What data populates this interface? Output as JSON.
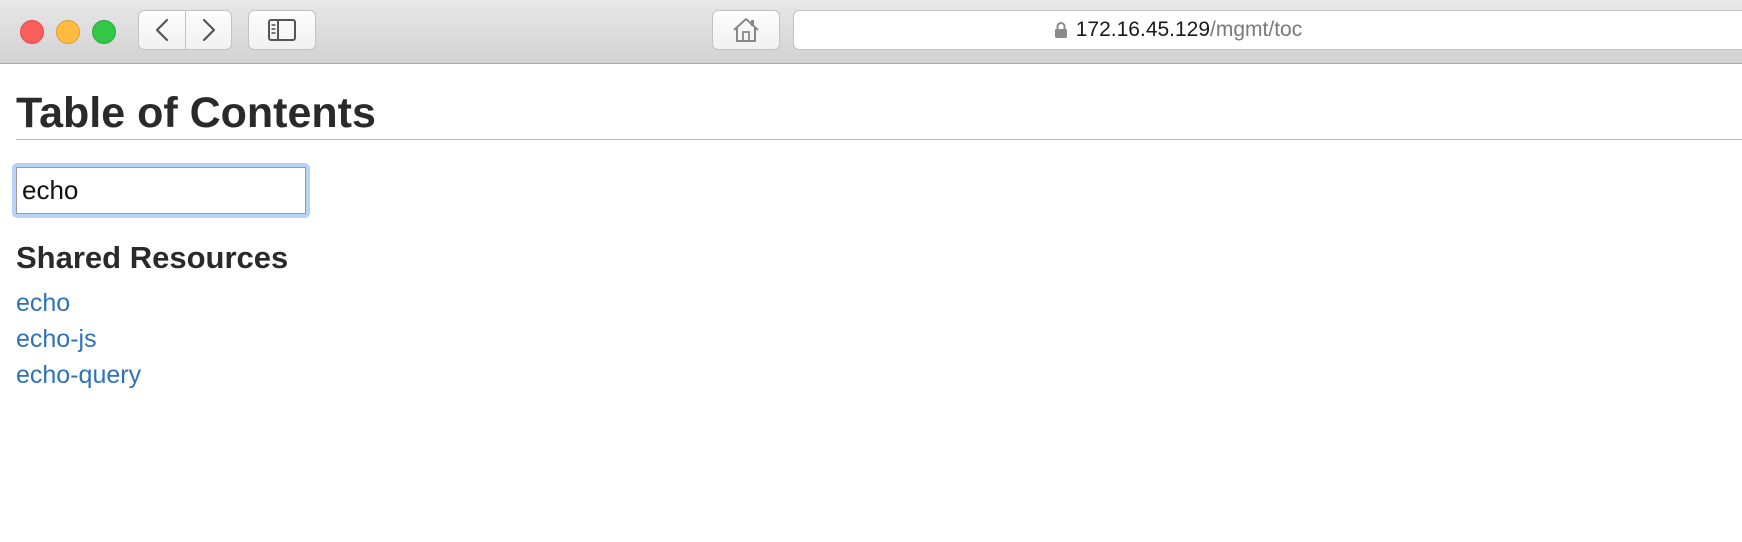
{
  "browser": {
    "url_host": "172.16.45.129",
    "url_path": "/mgmt/toc"
  },
  "page": {
    "title": "Table of Contents",
    "search": {
      "value": "echo",
      "placeholder": ""
    },
    "section_title": "Shared Resources",
    "links": [
      "echo",
      "echo-js",
      "echo-query"
    ]
  },
  "colors": {
    "link": "#2f72b8",
    "focus_ring": "#b5d5f8"
  },
  "icons": {
    "lock": "lock-icon",
    "back": "chevron-left-icon",
    "forward": "chevron-right-icon",
    "sidebar": "sidebar-icon",
    "home": "home-icon"
  }
}
